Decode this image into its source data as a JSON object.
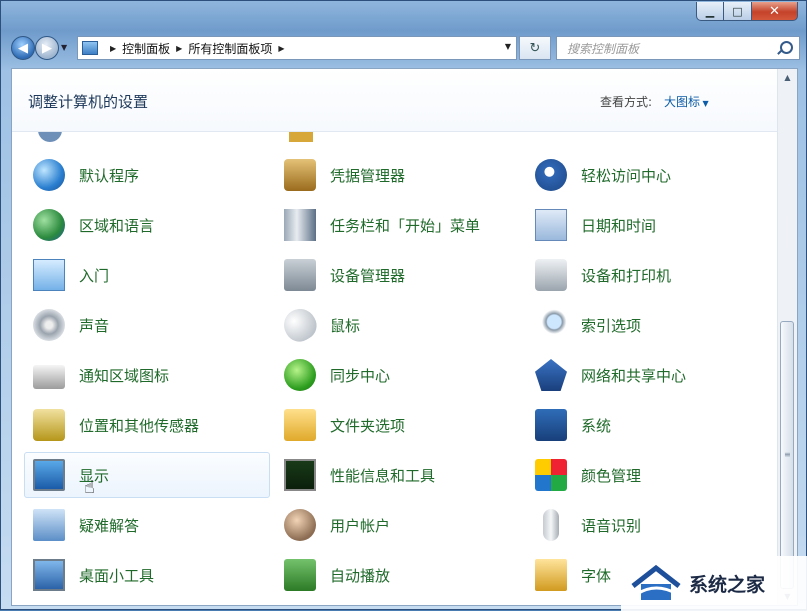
{
  "window": {
    "controls": {
      "minimize": "▁",
      "maximize": "□",
      "close": "✕"
    }
  },
  "nav": {
    "back": "◀",
    "forward": "▶",
    "breadcrumb": [
      "控制面板",
      "所有控制面板项"
    ],
    "refresh": "↻",
    "search_placeholder": "搜索控制面板"
  },
  "header": {
    "title": "调整计算机的设置",
    "view_by_label": "查看方式:",
    "view_by_value": "大图标"
  },
  "items": [
    {
      "label": "默认程序",
      "icon": "default-programs-icon"
    },
    {
      "label": "凭据管理器",
      "icon": "credential-manager-icon"
    },
    {
      "label": "轻松访问中心",
      "icon": "ease-of-access-icon"
    },
    {
      "label": "区域和语言",
      "icon": "region-language-icon"
    },
    {
      "label": "任务栏和「开始」菜单",
      "icon": "taskbar-start-menu-icon"
    },
    {
      "label": "日期和时间",
      "icon": "date-time-icon"
    },
    {
      "label": "入门",
      "icon": "getting-started-icon"
    },
    {
      "label": "设备管理器",
      "icon": "device-manager-icon"
    },
    {
      "label": "设备和打印机",
      "icon": "devices-printers-icon"
    },
    {
      "label": "声音",
      "icon": "sound-icon"
    },
    {
      "label": "鼠标",
      "icon": "mouse-icon"
    },
    {
      "label": "索引选项",
      "icon": "indexing-options-icon"
    },
    {
      "label": "通知区域图标",
      "icon": "notification-area-icon"
    },
    {
      "label": "同步中心",
      "icon": "sync-center-icon"
    },
    {
      "label": "网络和共享中心",
      "icon": "network-sharing-icon"
    },
    {
      "label": "位置和其他传感器",
      "icon": "location-sensors-icon"
    },
    {
      "label": "文件夹选项",
      "icon": "folder-options-icon"
    },
    {
      "label": "系统",
      "icon": "system-icon"
    },
    {
      "label": "显示",
      "icon": "display-icon"
    },
    {
      "label": "性能信息和工具",
      "icon": "performance-icon"
    },
    {
      "label": "颜色管理",
      "icon": "color-management-icon"
    },
    {
      "label": "疑难解答",
      "icon": "troubleshooting-icon"
    },
    {
      "label": "用户帐户",
      "icon": "user-accounts-icon"
    },
    {
      "label": "语音识别",
      "icon": "speech-recognition-icon"
    },
    {
      "label": "桌面小工具",
      "icon": "desktop-gadgets-icon"
    },
    {
      "label": "自动播放",
      "icon": "autoplay-icon"
    },
    {
      "label": "字体",
      "icon": "fonts-icon"
    }
  ],
  "watermark": {
    "text": "系统之家"
  }
}
